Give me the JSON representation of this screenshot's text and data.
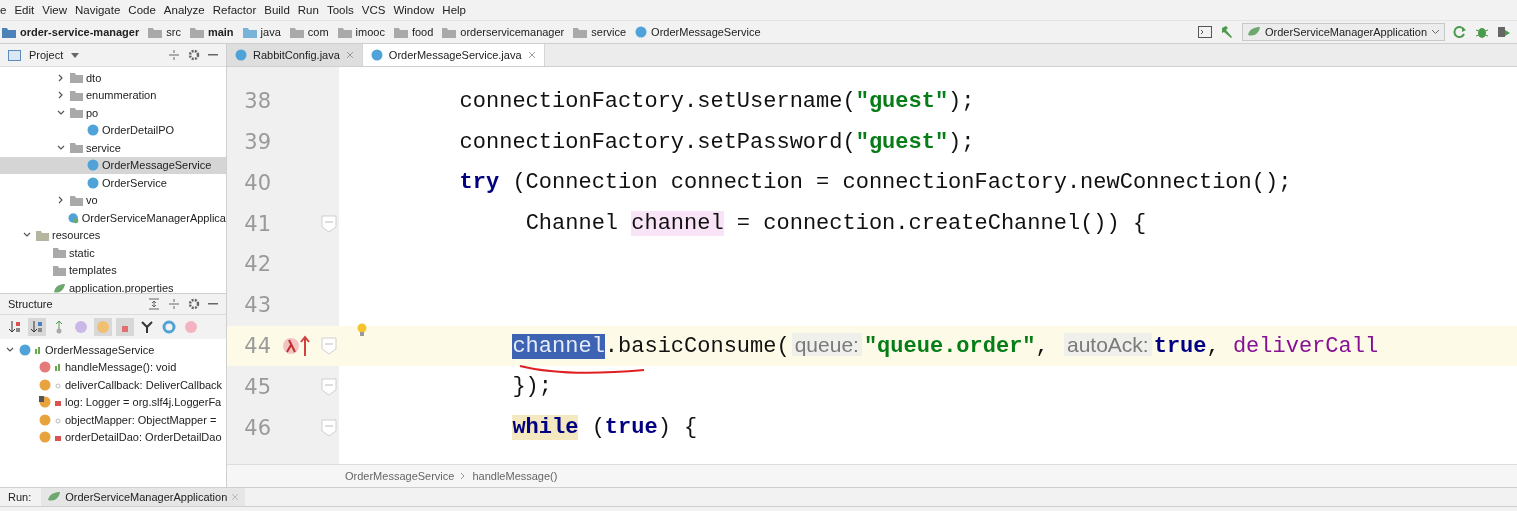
{
  "menu": [
    "e",
    "Edit",
    "View",
    "Navigate",
    "Code",
    "Analyze",
    "Refactor",
    "Build",
    "Run",
    "Tools",
    "VCS",
    "Window",
    "Help"
  ],
  "nav_bar": {
    "crumbs": [
      {
        "label": "order-service-manager",
        "kind": "module",
        "bold": true
      },
      {
        "label": "src",
        "kind": "folder",
        "bold": false
      },
      {
        "label": "main",
        "kind": "source-folder",
        "bold": true
      },
      {
        "label": "java",
        "kind": "source-root",
        "bold": false
      },
      {
        "label": "com",
        "kind": "package",
        "bold": false
      },
      {
        "label": "imooc",
        "kind": "package",
        "bold": false
      },
      {
        "label": "food",
        "kind": "package",
        "bold": false
      },
      {
        "label": "orderservicemanager",
        "kind": "package",
        "bold": false
      },
      {
        "label": "service",
        "kind": "package",
        "bold": false
      },
      {
        "label": "OrderMessageService",
        "kind": "class",
        "bold": false
      }
    ],
    "run_config": "OrderServiceManagerApplication"
  },
  "project_panel": {
    "title": "Project",
    "package_items": [
      {
        "label": "dto",
        "kind": "folder",
        "expanded": false,
        "selected": false
      },
      {
        "label": "enummeration",
        "kind": "folder",
        "expanded": false,
        "selected": false
      },
      {
        "label": "po",
        "kind": "folder",
        "expanded": true,
        "selected": false,
        "children": [
          {
            "label": "OrderDetailPO",
            "kind": "class",
            "selected": false
          }
        ]
      },
      {
        "label": "service",
        "kind": "folder",
        "expanded": true,
        "selected": false,
        "children": [
          {
            "label": "OrderMessageService",
            "kind": "class",
            "selected": true
          },
          {
            "label": "OrderService",
            "kind": "class",
            "selected": false
          }
        ]
      },
      {
        "label": "vo",
        "kind": "folder",
        "expanded": false,
        "selected": false
      },
      {
        "label": "OrderServiceManagerApplica",
        "kind": "app-class",
        "selected": false
      }
    ],
    "resources": {
      "label": "resources",
      "kind": "resources",
      "expanded": true,
      "selected": false,
      "children": [
        {
          "label": "static",
          "kind": "plain-folder",
          "selected": false
        },
        {
          "label": "templates",
          "kind": "plain-folder",
          "selected": false
        },
        {
          "label": "application.properties",
          "kind": "properties",
          "selected": false
        }
      ]
    }
  },
  "structure_panel": {
    "title": "Structure",
    "toolbar": [
      {
        "kind": "sort-visibility",
        "on": false
      },
      {
        "kind": "sort-alpha",
        "on": true
      },
      {
        "kind": "inherited",
        "on": false
      },
      {
        "kind": "properties",
        "on": false
      },
      {
        "kind": "fields",
        "on": true
      },
      {
        "kind": "non-public",
        "on": true
      },
      {
        "kind": "anonymous",
        "on": false
      },
      {
        "kind": "lambda-class",
        "on": false
      },
      {
        "kind": "lambdas",
        "on": false
      }
    ],
    "tree": [
      {
        "label": "OrderMessageService",
        "kind": "public-class",
        "expanded": true,
        "children": [
          {
            "label": "handleMessage(): void",
            "kind": "public-method"
          },
          {
            "label": "deliverCallback: DeliverCallback",
            "kind": "package-field"
          },
          {
            "label": "log: Logger = org.slf4j.LoggerFa",
            "kind": "private-static-field"
          },
          {
            "label": "objectMapper: ObjectMapper =",
            "kind": "package-field"
          },
          {
            "label": "orderDetailDao: OrderDetailDao",
            "kind": "private-field"
          }
        ]
      }
    ]
  },
  "editor": {
    "tabs": [
      {
        "label": "RabbitConfig.java",
        "selected": false
      },
      {
        "label": "OrderMessageService.java",
        "selected": true
      }
    ],
    "lines": [
      {
        "number": "38",
        "kind": "statement",
        "current": false,
        "fold": false,
        "tokens": [
          {
            "kind": "plain",
            "text": "connectionFactory.setUsername("
          },
          {
            "kind": "string",
            "text": "\"guest\""
          },
          {
            "kind": "plain",
            "text": ");"
          }
        ]
      },
      {
        "number": "39",
        "kind": "statement",
        "current": false,
        "fold": false,
        "tokens": [
          {
            "kind": "plain",
            "text": "connectionFactory.setPassword("
          },
          {
            "kind": "string",
            "text": "\"guest\""
          },
          {
            "kind": "plain",
            "text": ");"
          }
        ]
      },
      {
        "number": "40",
        "kind": "statement",
        "current": false,
        "fold": false,
        "tokens": [
          {
            "kind": "keyword",
            "text": "try"
          },
          {
            "kind": "plain",
            "text": " (Connection connection = connectionFactory.newConnection();"
          }
        ],
        "children": [
          {
            "number": "41",
            "kind": "continuation",
            "current": false,
            "fold": true,
            "tokens": [
              {
                "kind": "plain",
                "text": "Channel "
              },
              {
                "kind": "usage",
                "text": "channel"
              },
              {
                "kind": "plain",
                "text": " = connection.createChannel()) {"
              }
            ]
          },
          {
            "number": "42",
            "current": false,
            "fold": false
          },
          {
            "number": "43",
            "current": false,
            "fold": false
          },
          {
            "number": "44",
            "kind": "statement",
            "current": true,
            "fold": true,
            "lambda_marker": true,
            "bulb": true,
            "tokens": [
              {
                "kind": "selected",
                "text": "channel"
              },
              {
                "kind": "plain",
                "text": ".basicConsume("
              },
              {
                "kind": "hint",
                "text": "queue:"
              },
              {
                "kind": "string",
                "text": "\"queue.order\""
              },
              {
                "kind": "plain",
                "text": ", "
              },
              {
                "kind": "hint",
                "text": "autoAck:"
              },
              {
                "kind": "keyword",
                "text": "true"
              },
              {
                "kind": "plain",
                "text": ", "
              },
              {
                "kind": "field",
                "text": "deliverCall"
              }
            ]
          },
          {
            "number": "45",
            "kind": "statement",
            "current": false,
            "fold": true,
            "tokens": [
              {
                "kind": "plain",
                "text": "});"
              }
            ]
          },
          {
            "number": "46",
            "kind": "statement",
            "current": false,
            "fold": true,
            "tokens": [
              {
                "kind": "keyword-match",
                "text": "while"
              },
              {
                "kind": "plain",
                "text": " ("
              },
              {
                "kind": "keyword",
                "text": "true"
              },
              {
                "kind": "plain",
                "text": ") {"
              }
            ]
          }
        ]
      }
    ],
    "breadcrumbs": [
      "OrderMessageService",
      "handleMessage()"
    ]
  },
  "run_bar": {
    "label": "Run:",
    "tab": "OrderServiceManagerApplication"
  }
}
